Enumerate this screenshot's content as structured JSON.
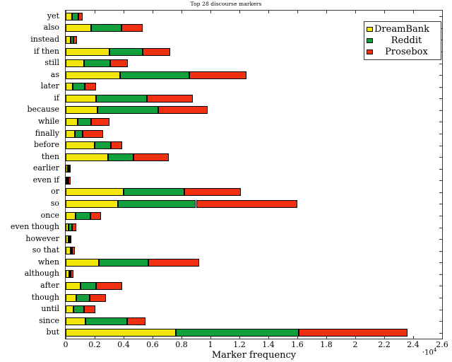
{
  "chart_data": {
    "type": "bar",
    "orientation": "horizontal",
    "stacked": true,
    "title": "Top 28 discourse markers",
    "xlabel": "Marker frequency",
    "ylabel": "",
    "x_multiplier": "·10",
    "x_multiplier_exponent": "4",
    "xlim": [
      0,
      26000
    ],
    "xticks": [
      0,
      2000,
      4000,
      6000,
      8000,
      10000,
      12000,
      14000,
      16000,
      18000,
      20000,
      22000,
      24000,
      26000
    ],
    "xtick_labels": [
      "0",
      "0.2",
      "0.4",
      "0.6",
      "0.8",
      "1",
      "1.2",
      "1.4",
      "1.6",
      "1.8",
      "2",
      "2.2",
      "2.4",
      "2.6"
    ],
    "grid": false,
    "legend_position": "top-right",
    "categories": [
      "yet",
      "also",
      "instead",
      "if then",
      "still",
      "as",
      "later",
      "if",
      "because",
      "while",
      "finally",
      "before",
      "then",
      "earlier",
      "even if",
      "or",
      "so",
      "once",
      "even though",
      "however",
      "so that",
      "when",
      "although",
      "after",
      "though",
      "until",
      "since",
      "but"
    ],
    "series": [
      {
        "name": "DreamBank",
        "color": "#f2e60a",
        "values": [
          420,
          1750,
          320,
          3000,
          1250,
          3750,
          500,
          2100,
          2200,
          850,
          650,
          2000,
          2950,
          130,
          110,
          4000,
          3600,
          700,
          200,
          180,
          330,
          2300,
          220,
          1000,
          750,
          550,
          1350,
          7600
        ]
      },
      {
        "name": "Reddit",
        "color": "#12a03c",
        "values": [
          480,
          2100,
          220,
          2300,
          1800,
          4800,
          800,
          3500,
          4200,
          900,
          500,
          1100,
          1750,
          90,
          100,
          4200,
          5400,
          1000,
          260,
          120,
          100,
          3400,
          140,
          1100,
          900,
          700,
          2900,
          8500
        ]
      },
      {
        "name": "Prosebox",
        "color": "#f03010",
        "values": [
          290,
          1450,
          260,
          1900,
          1250,
          3950,
          800,
          3200,
          3400,
          1250,
          1450,
          800,
          2400,
          130,
          120,
          3900,
          7000,
          750,
          260,
          100,
          220,
          3500,
          180,
          1800,
          1150,
          800,
          1250,
          7500
        ]
      }
    ],
    "totals": [
      1190,
      5300,
      800,
      7200,
      4300,
      12500,
      2100,
      8800,
      9800,
      3000,
      2600,
      3900,
      7100,
      350,
      330,
      12100,
      16000,
      2450,
      720,
      400,
      650,
      9200,
      540,
      3900,
      2800,
      2050,
      5500,
      23600
    ]
  },
  "legend": {
    "items": [
      {
        "label": "DreamBank",
        "color": "#f2e60a"
      },
      {
        "label": "Reddit",
        "color": "#12a03c"
      },
      {
        "label": "Prosebox",
        "color": "#f03010"
      }
    ]
  },
  "axis": {
    "x_title": "Marker frequency",
    "x_multiplier_text": "·10",
    "x_multiplier_exp": "4"
  }
}
